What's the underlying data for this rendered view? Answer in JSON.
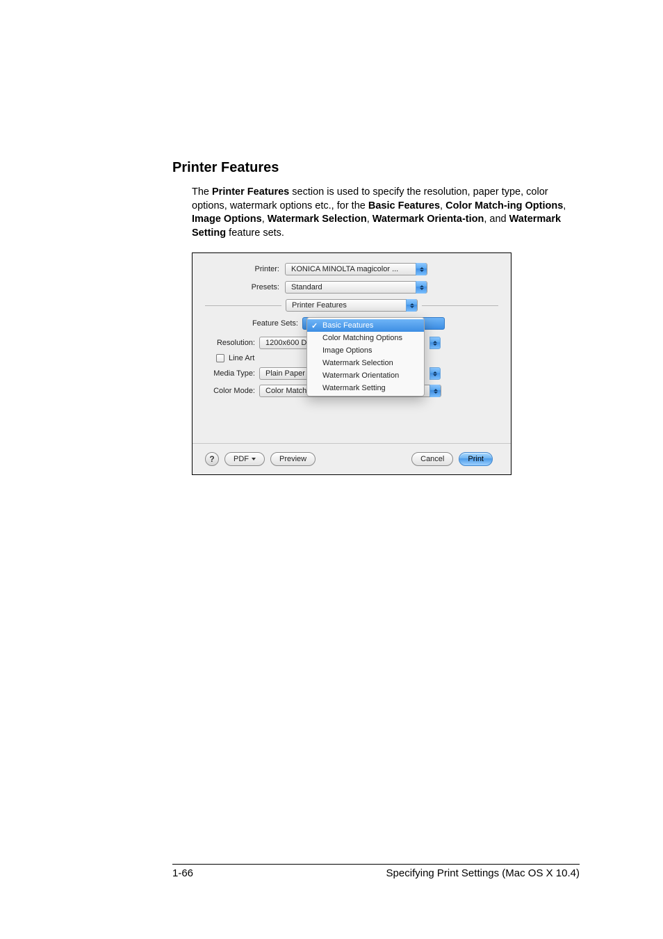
{
  "heading": "Printer Features",
  "body": {
    "t1": "The ",
    "b1": "Printer Features",
    "t2": " section is used to specify the resolution, paper type, color options, watermark options etc., for the ",
    "b2": "Basic Features",
    "t3": ", ",
    "b3": "Color Match-",
    "b3b": "ing Options",
    "t4": ", ",
    "b4": "Image Options",
    "t5": ", ",
    "b5": "Watermark Selection",
    "t6": ", ",
    "b6": "Watermark Orienta-",
    "b6b": "tion",
    "t7": ", and ",
    "b7": "Watermark Setting",
    "t8": " feature sets."
  },
  "dialog": {
    "printer_label": "Printer:",
    "printer_value": "KONICA MINOLTA magicolor ...",
    "presets_label": "Presets:",
    "presets_value": "Standard",
    "group_select": "Printer Features",
    "feature_sets_label": "Feature Sets:",
    "menu": {
      "selected": "Basic Features",
      "check": "✓",
      "items": [
        "Basic Features",
        "Color Matching Options",
        "Image Options",
        "Watermark Selection",
        "Watermark Orientation",
        "Watermark Setting"
      ]
    },
    "resolution_label": "Resolution:",
    "resolution_value": "1200x600 D",
    "lineart_label": "Line Art",
    "mediatype_label": "Media Type:",
    "mediatype_value": "Plain Paper",
    "colormode_label": "Color Mode:",
    "colormode_value": "Color Matching On",
    "help": "?",
    "pdf_btn": "PDF ",
    "preview_btn": "Preview",
    "cancel_btn": "Cancel",
    "print_btn": "Print"
  },
  "footer": {
    "page": "1-66",
    "title": "Specifying Print Settings (Mac OS X 10.4)"
  }
}
